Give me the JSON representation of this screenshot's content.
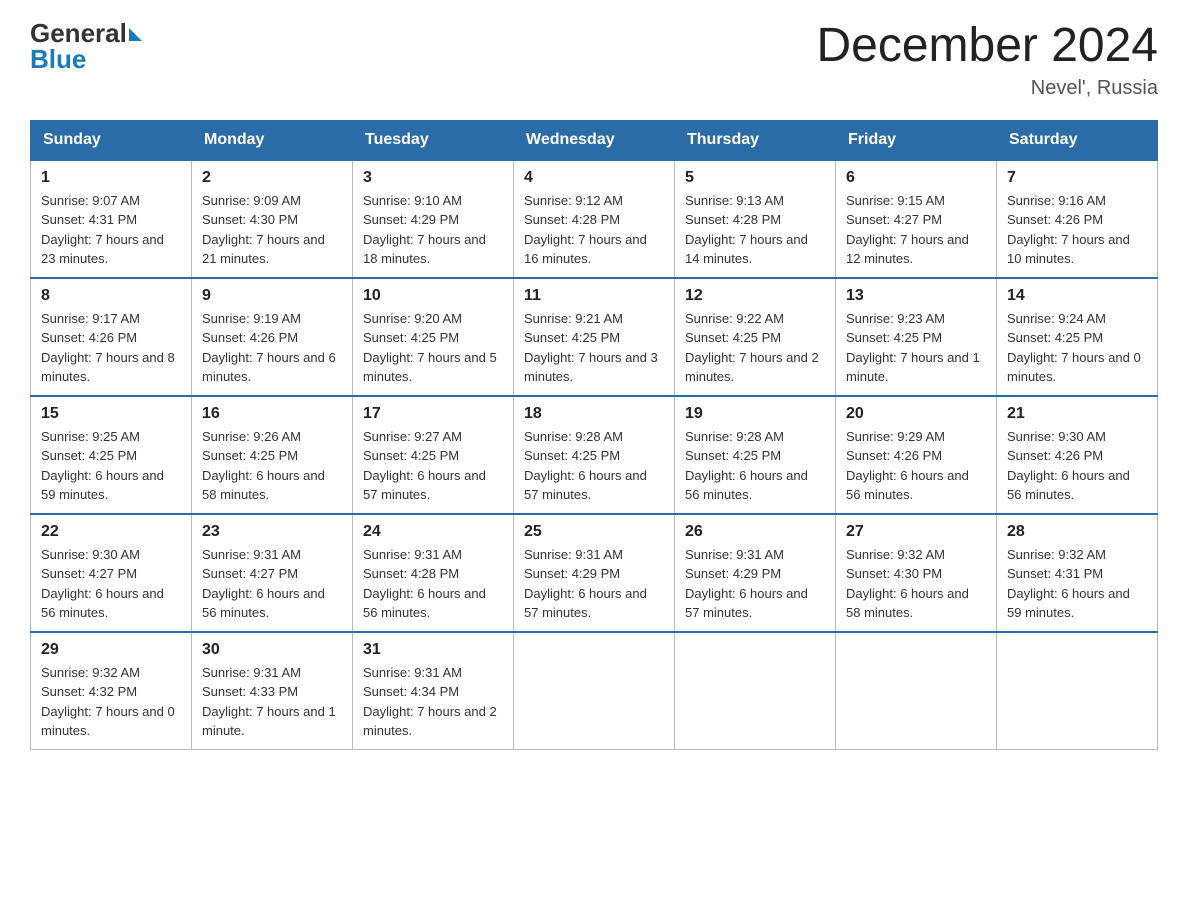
{
  "logo": {
    "general": "General",
    "blue": "Blue",
    "triangle": "▶"
  },
  "header": {
    "title": "December 2024",
    "subtitle": "Nevel', Russia"
  },
  "days_of_week": [
    "Sunday",
    "Monday",
    "Tuesday",
    "Wednesday",
    "Thursday",
    "Friday",
    "Saturday"
  ],
  "weeks": [
    [
      {
        "day": "1",
        "sunrise": "9:07 AM",
        "sunset": "4:31 PM",
        "daylight": "7 hours and 23 minutes."
      },
      {
        "day": "2",
        "sunrise": "9:09 AM",
        "sunset": "4:30 PM",
        "daylight": "7 hours and 21 minutes."
      },
      {
        "day": "3",
        "sunrise": "9:10 AM",
        "sunset": "4:29 PM",
        "daylight": "7 hours and 18 minutes."
      },
      {
        "day": "4",
        "sunrise": "9:12 AM",
        "sunset": "4:28 PM",
        "daylight": "7 hours and 16 minutes."
      },
      {
        "day": "5",
        "sunrise": "9:13 AM",
        "sunset": "4:28 PM",
        "daylight": "7 hours and 14 minutes."
      },
      {
        "day": "6",
        "sunrise": "9:15 AM",
        "sunset": "4:27 PM",
        "daylight": "7 hours and 12 minutes."
      },
      {
        "day": "7",
        "sunrise": "9:16 AM",
        "sunset": "4:26 PM",
        "daylight": "7 hours and 10 minutes."
      }
    ],
    [
      {
        "day": "8",
        "sunrise": "9:17 AM",
        "sunset": "4:26 PM",
        "daylight": "7 hours and 8 minutes."
      },
      {
        "day": "9",
        "sunrise": "9:19 AM",
        "sunset": "4:26 PM",
        "daylight": "7 hours and 6 minutes."
      },
      {
        "day": "10",
        "sunrise": "9:20 AM",
        "sunset": "4:25 PM",
        "daylight": "7 hours and 5 minutes."
      },
      {
        "day": "11",
        "sunrise": "9:21 AM",
        "sunset": "4:25 PM",
        "daylight": "7 hours and 3 minutes."
      },
      {
        "day": "12",
        "sunrise": "9:22 AM",
        "sunset": "4:25 PM",
        "daylight": "7 hours and 2 minutes."
      },
      {
        "day": "13",
        "sunrise": "9:23 AM",
        "sunset": "4:25 PM",
        "daylight": "7 hours and 1 minute."
      },
      {
        "day": "14",
        "sunrise": "9:24 AM",
        "sunset": "4:25 PM",
        "daylight": "7 hours and 0 minutes."
      }
    ],
    [
      {
        "day": "15",
        "sunrise": "9:25 AM",
        "sunset": "4:25 PM",
        "daylight": "6 hours and 59 minutes."
      },
      {
        "day": "16",
        "sunrise": "9:26 AM",
        "sunset": "4:25 PM",
        "daylight": "6 hours and 58 minutes."
      },
      {
        "day": "17",
        "sunrise": "9:27 AM",
        "sunset": "4:25 PM",
        "daylight": "6 hours and 57 minutes."
      },
      {
        "day": "18",
        "sunrise": "9:28 AM",
        "sunset": "4:25 PM",
        "daylight": "6 hours and 57 minutes."
      },
      {
        "day": "19",
        "sunrise": "9:28 AM",
        "sunset": "4:25 PM",
        "daylight": "6 hours and 56 minutes."
      },
      {
        "day": "20",
        "sunrise": "9:29 AM",
        "sunset": "4:26 PM",
        "daylight": "6 hours and 56 minutes."
      },
      {
        "day": "21",
        "sunrise": "9:30 AM",
        "sunset": "4:26 PM",
        "daylight": "6 hours and 56 minutes."
      }
    ],
    [
      {
        "day": "22",
        "sunrise": "9:30 AM",
        "sunset": "4:27 PM",
        "daylight": "6 hours and 56 minutes."
      },
      {
        "day": "23",
        "sunrise": "9:31 AM",
        "sunset": "4:27 PM",
        "daylight": "6 hours and 56 minutes."
      },
      {
        "day": "24",
        "sunrise": "9:31 AM",
        "sunset": "4:28 PM",
        "daylight": "6 hours and 56 minutes."
      },
      {
        "day": "25",
        "sunrise": "9:31 AM",
        "sunset": "4:29 PM",
        "daylight": "6 hours and 57 minutes."
      },
      {
        "day": "26",
        "sunrise": "9:31 AM",
        "sunset": "4:29 PM",
        "daylight": "6 hours and 57 minutes."
      },
      {
        "day": "27",
        "sunrise": "9:32 AM",
        "sunset": "4:30 PM",
        "daylight": "6 hours and 58 minutes."
      },
      {
        "day": "28",
        "sunrise": "9:32 AM",
        "sunset": "4:31 PM",
        "daylight": "6 hours and 59 minutes."
      }
    ],
    [
      {
        "day": "29",
        "sunrise": "9:32 AM",
        "sunset": "4:32 PM",
        "daylight": "7 hours and 0 minutes."
      },
      {
        "day": "30",
        "sunrise": "9:31 AM",
        "sunset": "4:33 PM",
        "daylight": "7 hours and 1 minute."
      },
      {
        "day": "31",
        "sunrise": "9:31 AM",
        "sunset": "4:34 PM",
        "daylight": "7 hours and 2 minutes."
      },
      null,
      null,
      null,
      null
    ]
  ]
}
